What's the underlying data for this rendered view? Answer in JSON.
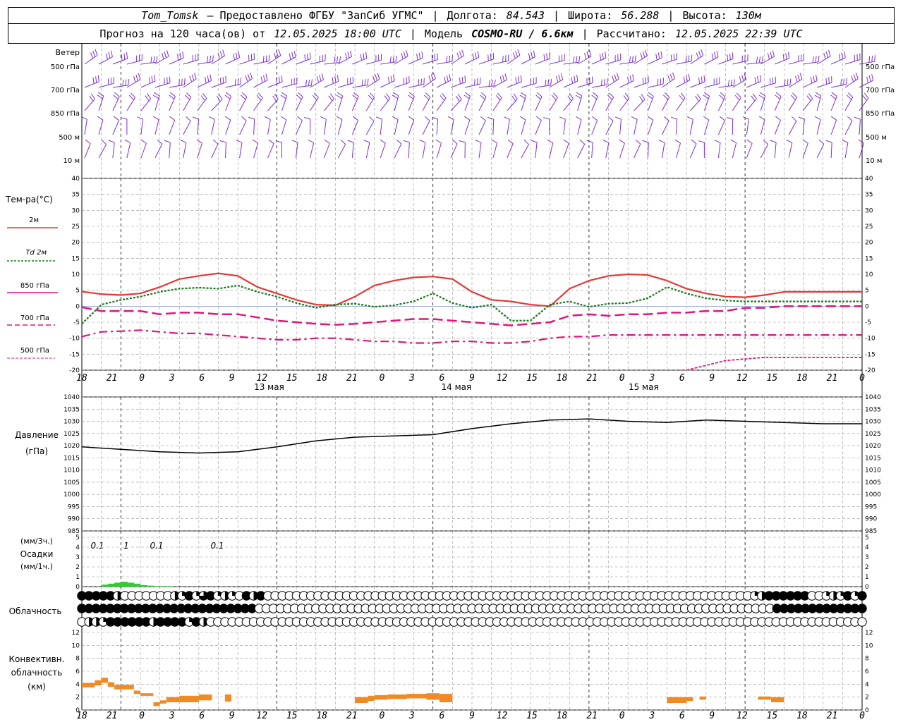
{
  "header": {
    "station": "Tom_Tomsk",
    "provider": "– Предоставлено ФГБУ \"ЗапСиб УГМС\"",
    "longitude_label": "Долгота:",
    "longitude": "84.543",
    "latitude_label": "Широта:",
    "latitude": "56.288",
    "altitude_label": "Высота:",
    "altitude": "130м",
    "forecast_label": "Прогноз на 120 часа(ов) от",
    "forecast_start": "12.05.2025 18:00 UTC",
    "model_label": "Модель",
    "model": "COSMO-RU / 6.6км",
    "computed_label": "Рассчитано:",
    "computed": "12.05.2025 22:39 UTC"
  },
  "panels": {
    "wind": {
      "title": "Ветер",
      "levels": [
        "500 гПа",
        "700 гПа",
        "850 гПа",
        "500 м",
        "10 м"
      ]
    },
    "temperature": {
      "title": "Тем-ра(°С)",
      "legend": [
        "2м",
        "Td 2м",
        "850 гПа",
        "700 гПа",
        "500 гПа"
      ]
    },
    "pressure": {
      "title1": "Давление",
      "title2": "(гПа)"
    },
    "precip": {
      "title1": "(мм/3ч.)",
      "title2": "Осадки",
      "title3": "(мм/1ч.)",
      "labels": [
        "0.1",
        "1",
        "0.1",
        "0.1"
      ]
    },
    "cloud": {
      "title": "Облачность"
    },
    "convective": {
      "title1": "Конвективн.",
      "title2": "облачность",
      "title3": "(км)"
    }
  },
  "time_axis": {
    "hour_labels": [
      "18",
      "21",
      "0",
      "3",
      "6",
      "9",
      "12",
      "15",
      "18",
      "21",
      "0",
      "3",
      "6",
      "9",
      "12",
      "15",
      "18",
      "21",
      "0",
      "3",
      "6",
      "9",
      "12",
      "15",
      "18",
      "21",
      "0"
    ],
    "day_labels": [
      "13 мая",
      "14 мая",
      "15 мая"
    ]
  },
  "chart_data": [
    {
      "type": "line",
      "panel": "temperature",
      "ylim": [
        -20,
        40
      ],
      "yticks": [
        "40",
        "35",
        "30",
        "25",
        "20",
        "15",
        "10",
        "5",
        "0",
        "-5",
        "-10",
        "-15",
        "-20"
      ],
      "x_hours": [
        0,
        3,
        6,
        9,
        12,
        15,
        18,
        21,
        24,
        27,
        30,
        33,
        36,
        39,
        42,
        45,
        48,
        51,
        54,
        57,
        60,
        63,
        66,
        69,
        72,
        75,
        78,
        81,
        84,
        87,
        90,
        93,
        96,
        99,
        102,
        105,
        108,
        111,
        114,
        117,
        120
      ],
      "series": [
        {
          "name": "2м",
          "color": "#e53935",
          "values": [
            4.6,
            3.8,
            3.5,
            4.0,
            6.0,
            8.5,
            9.5,
            10.3,
            9.5,
            6.0,
            4.0,
            2.0,
            0.5,
            0.3,
            3.0,
            6.5,
            8.0,
            9.0,
            9.3,
            8.5,
            4.5,
            2.0,
            1.5,
            0.5,
            0.0,
            5.5,
            8.0,
            9.5,
            10.0,
            9.8,
            8.0,
            5.5,
            4.0,
            3.0,
            2.8,
            3.5,
            4.5,
            4.5,
            4.5,
            4.5,
            4.5
          ]
        },
        {
          "name": "Td 2м",
          "color": "#1a7a1a",
          "values": [
            -5.5,
            0.5,
            2.0,
            3.0,
            4.5,
            5.5,
            5.8,
            5.5,
            6.5,
            4.5,
            3.0,
            1.0,
            -0.5,
            0.5,
            0.8,
            -0.2,
            0.3,
            1.5,
            4.0,
            1.0,
            -0.5,
            0.5,
            -4.5,
            -4.5,
            0.5,
            1.5,
            -0.2,
            0.8,
            1.0,
            2.5,
            6.0,
            4.0,
            2.5,
            1.8,
            1.5,
            1.5,
            1.5,
            1.5,
            1.5,
            1.5,
            1.5
          ]
        },
        {
          "name": "850 гПа",
          "color": "#e0157a",
          "values": [
            -0.3,
            -1.5,
            -1.5,
            -1.5,
            -2.5,
            -2.0,
            -2.0,
            -2.5,
            -2.5,
            -3.5,
            -4.5,
            -5.0,
            -5.5,
            -5.8,
            -5.5,
            -5.0,
            -4.5,
            -4.0,
            -4.0,
            -4.5,
            -5.0,
            -5.5,
            -6.0,
            -5.5,
            -5.0,
            -3.0,
            -2.5,
            -3.0,
            -2.5,
            -2.5,
            -2.0,
            -2.0,
            -1.5,
            -1.5,
            -0.5,
            -0.5,
            0.0,
            0.0,
            0.0,
            0.0,
            0.0
          ]
        },
        {
          "name": "700 гПа",
          "color": "#e0157a",
          "values": [
            -9.5,
            -8.0,
            -7.8,
            -7.5,
            -8.0,
            -8.5,
            -8.5,
            -9.0,
            -9.5,
            -10.0,
            -10.5,
            -10.5,
            -10.0,
            -10.0,
            -10.5,
            -11.0,
            -11.0,
            -11.5,
            -11.5,
            -11.0,
            -11.0,
            -11.5,
            -11.5,
            -11.0,
            -10.0,
            -9.5,
            -9.5,
            -9.0,
            -9.0,
            -9.0,
            -9.0,
            -9.0,
            -9.0,
            -9.0,
            -9.0,
            -9.0,
            -9.0,
            -9.0,
            -9.0,
            -9.0,
            -9.0
          ]
        },
        {
          "name": "500 гПа",
          "color": "#e0157a",
          "values": [
            null,
            null,
            null,
            null,
            null,
            null,
            null,
            null,
            null,
            null,
            null,
            null,
            null,
            null,
            null,
            null,
            null,
            null,
            null,
            null,
            null,
            null,
            null,
            null,
            null,
            null,
            null,
            null,
            null,
            null,
            null,
            -20.0,
            -18.5,
            -17.0,
            -16.5,
            -16.0,
            -16.0,
            -16.0,
            -16.0,
            -16.0,
            -16.0
          ]
        }
      ]
    },
    {
      "type": "line",
      "panel": "pressure",
      "ylim": [
        985,
        1040
      ],
      "yticks": [
        "1040",
        "1035",
        "1030",
        "1025",
        "1020",
        "1015",
        "1010",
        "1005",
        "1000",
        "995",
        "990",
        "985"
      ],
      "x_hours": [
        0,
        6,
        12,
        18,
        24,
        30,
        36,
        42,
        48,
        54,
        60,
        66,
        72,
        78,
        84,
        90,
        96,
        102,
        108,
        114,
        120
      ],
      "series": [
        {
          "name": "Давление",
          "color": "#000000",
          "values": [
            1019.5,
            1018.5,
            1017.5,
            1017.0,
            1017.5,
            1019.5,
            1022.0,
            1023.5,
            1024.0,
            1024.5,
            1027.0,
            1029.0,
            1030.5,
            1031.0,
            1030.0,
            1029.5,
            1030.5,
            1030.0,
            1029.5,
            1029.0,
            1029.0
          ]
        }
      ]
    },
    {
      "type": "bar",
      "panel": "precipitation",
      "ylim": [
        0,
        5
      ],
      "yticks": [
        "5",
        "4",
        "3",
        "2",
        "1",
        "0"
      ],
      "x_hours": [
        3,
        4,
        5,
        6,
        7,
        8,
        9,
        10,
        11,
        12,
        13
      ],
      "values": [
        0.2,
        0.3,
        0.4,
        0.5,
        0.4,
        0.3,
        0.15,
        0.1,
        0.05,
        0.05,
        0.05
      ],
      "color": "#33cc33"
    },
    {
      "type": "bar",
      "panel": "convective_cloud",
      "ylim": [
        0,
        12
      ],
      "yticks": [
        "12",
        "10",
        "8",
        "6",
        "4",
        "2",
        "0"
      ],
      "segments": [
        {
          "h0": 0,
          "h1": 2,
          "bottom": 3.5,
          "top": 4.2
        },
        {
          "h0": 2,
          "h1": 3,
          "bottom": 3.8,
          "top": 4.6
        },
        {
          "h0": 3,
          "h1": 4,
          "bottom": 4.2,
          "top": 5.0
        },
        {
          "h0": 4,
          "h1": 5,
          "bottom": 3.6,
          "top": 4.3
        },
        {
          "h0": 5,
          "h1": 8,
          "bottom": 3.2,
          "top": 3.9
        },
        {
          "h0": 8,
          "h1": 9,
          "bottom": 2.5,
          "top": 3.0
        },
        {
          "h0": 9,
          "h1": 11,
          "bottom": 2.2,
          "top": 2.6
        },
        {
          "h0": 11,
          "h1": 12,
          "bottom": 0.6,
          "top": 1.2
        },
        {
          "h0": 12,
          "h1": 13,
          "bottom": 1.0,
          "top": 1.5
        },
        {
          "h0": 13,
          "h1": 15,
          "bottom": 1.2,
          "top": 2.0
        },
        {
          "h0": 15,
          "h1": 18,
          "bottom": 1.2,
          "top": 2.2
        },
        {
          "h0": 18,
          "h1": 20,
          "bottom": 1.5,
          "top": 2.4
        },
        {
          "h0": 22,
          "h1": 23,
          "bottom": 1.3,
          "top": 2.4
        },
        {
          "h0": 42,
          "h1": 44,
          "bottom": 1.1,
          "top": 2.0
        },
        {
          "h0": 44,
          "h1": 45,
          "bottom": 1.4,
          "top": 2.2
        },
        {
          "h0": 45,
          "h1": 47,
          "bottom": 1.6,
          "top": 2.3
        },
        {
          "h0": 47,
          "h1": 50,
          "bottom": 1.7,
          "top": 2.4
        },
        {
          "h0": 50,
          "h1": 53,
          "bottom": 1.8,
          "top": 2.5
        },
        {
          "h0": 53,
          "h1": 55,
          "bottom": 1.6,
          "top": 2.6
        },
        {
          "h0": 55,
          "h1": 57,
          "bottom": 1.2,
          "top": 2.5
        },
        {
          "h0": 90,
          "h1": 93,
          "bottom": 1.1,
          "top": 2.0
        },
        {
          "h0": 93,
          "h1": 94,
          "bottom": 1.4,
          "top": 2.0
        },
        {
          "h0": 95,
          "h1": 96,
          "bottom": 1.6,
          "top": 2.1
        },
        {
          "h0": 104,
          "h1": 106,
          "bottom": 1.6,
          "top": 2.1
        },
        {
          "h0": 106,
          "h1": 108,
          "bottom": 1.2,
          "top": 2.0
        }
      ],
      "color": "#f08a24"
    }
  ],
  "cloud_rows": {
    "high": "FFFFFHOOOOOOOHQFQTFQHQOFHFOOOOOOOOOOOOOOOOOOOOOOOOOOOOOOOOOOOOOOOOOOOOOOOOOOOOOOOOOOOOOOOOOOOOQHFFFFFFOOQHQFQF",
    "mid": "FFFFFFFFFFFFFFFFFFFFFFFFFOOOOOOOOOOOOOOOOOOOOOOOOOOOOOOOOOOOOOOOOOOOOOOOOOOOOOOOOOOOOOOOOOOOOOOOOOFFFFFFFFFFFFF",
    "low": "OHHQFFFFFFHFFFFQFHOOOOOOOOOOOOOOOOOOOOOOOOOOOOOOOOOOOOOOOOOOOOOOOOOOOOOOOOOOOOOOOOOOOOOOOOOOOOOOOOOOOOOOOOOOOO"
  },
  "colors": {
    "wind_barb": "#7b2fd6",
    "grid": "#999999"
  }
}
